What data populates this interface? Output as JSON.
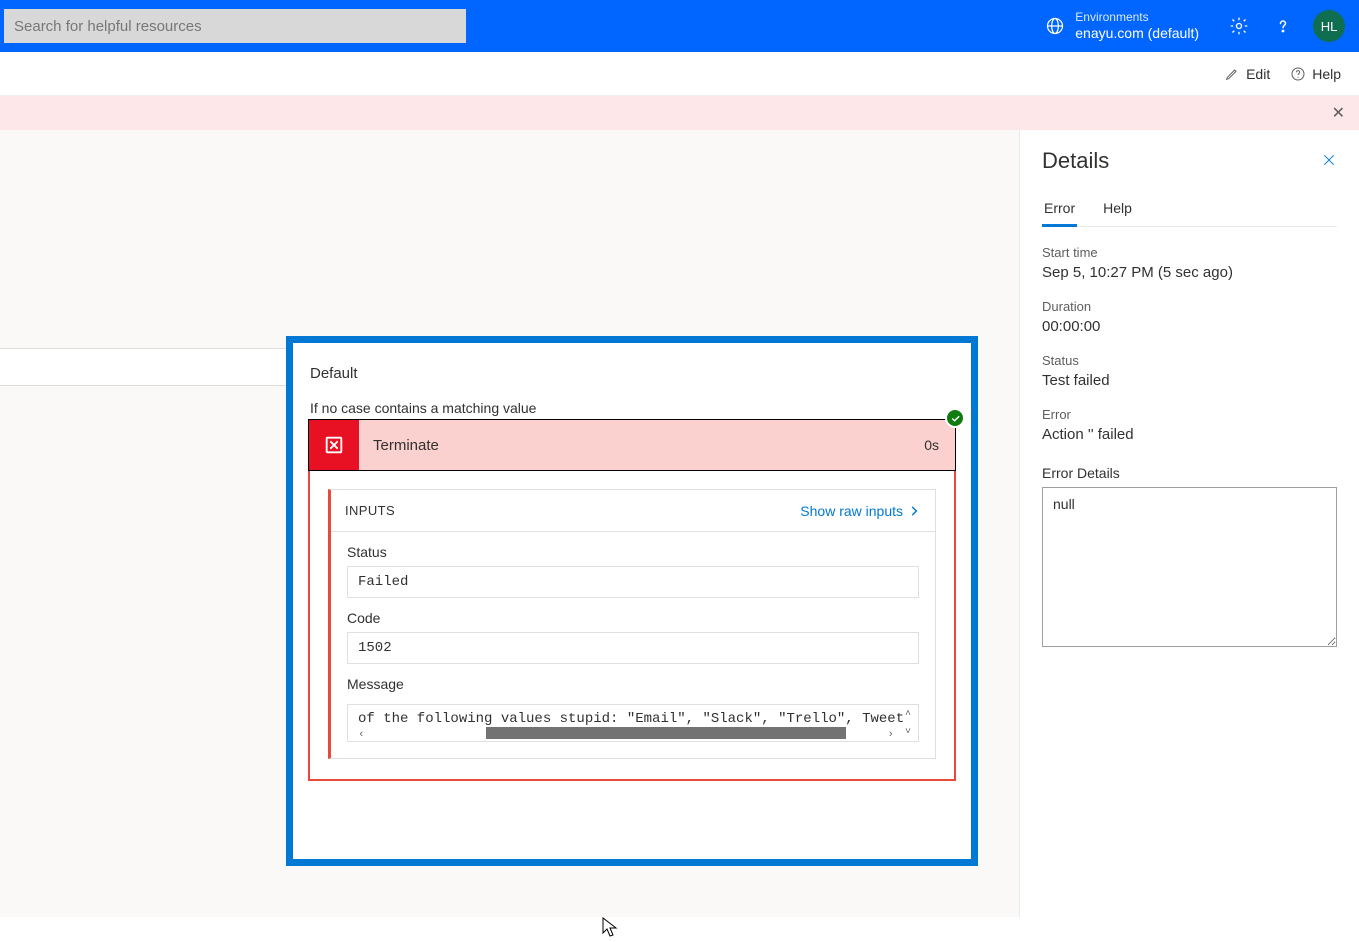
{
  "header": {
    "search_placeholder": "Search for helpful resources",
    "env_label": "Environments",
    "env_value": "enayu.com (default)",
    "avatar_initials": "HL"
  },
  "commandbar": {
    "edit_label": "Edit",
    "help_label": "Help"
  },
  "flow": {
    "card_title": "Default",
    "card_subtitle": "If no case contains a matching value",
    "action_name": "Terminate",
    "action_duration": "0s",
    "inputs_label": "INPUTS",
    "raw_inputs_link": "Show raw inputs",
    "fields": {
      "status_label": "Status",
      "status_value": "Failed",
      "code_label": "Code",
      "code_value": "1502",
      "message_label": "Message",
      "message_value": "of the following values stupid: \"Email\", \"Slack\", \"Trello\", Tweet"
    }
  },
  "details": {
    "panel_title": "Details",
    "tabs": {
      "error": "Error",
      "help": "Help"
    },
    "start_time_label": "Start time",
    "start_time_value": "Sep 5, 10:27 PM (5 sec ago)",
    "duration_label": "Duration",
    "duration_value": "00:00:00",
    "status_label": "Status",
    "status_value": "Test failed",
    "error_label": "Error",
    "error_value": "Action '' failed",
    "error_details_label": "Error Details",
    "error_details_value": "null"
  }
}
